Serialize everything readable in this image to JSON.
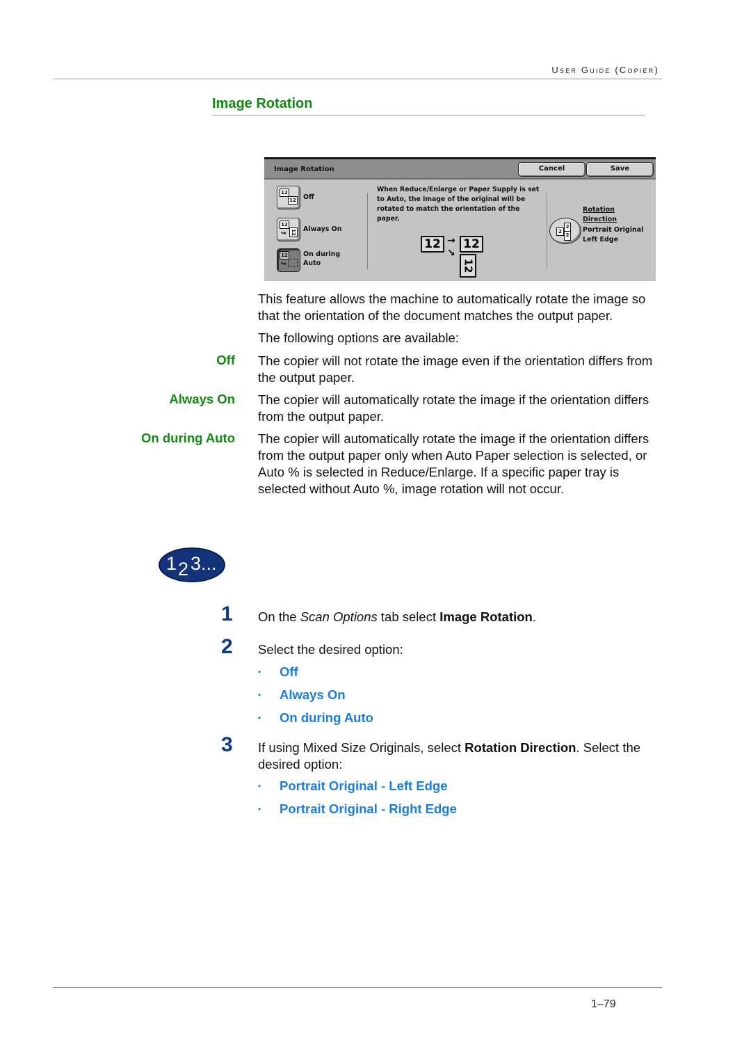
{
  "header": {
    "running_head": "User Guide (Copier)"
  },
  "section": {
    "title": "Image Rotation"
  },
  "screen": {
    "title": "Image Rotation",
    "cancel_label": "Cancel",
    "save_label": "Save",
    "options": [
      {
        "label_line1": "Off",
        "label_line2": "",
        "icon": "no-rotation-icon",
        "selected": false
      },
      {
        "label_line1": "Always On",
        "label_line2": "",
        "icon": "rotate-always-icon",
        "selected": false
      },
      {
        "label_line1": "On during",
        "label_line2": "Auto",
        "icon": "rotate-auto-icon",
        "selected": true
      }
    ],
    "description": "When Reduce/Enlarge or Paper Supply is set to Auto, the image of the original will be rotated to match the orientation of the paper.",
    "diagram": {
      "source": "12",
      "target": "12",
      "rotated": "12"
    },
    "rotation_title_line1": "Rotation",
    "rotation_title_line2": "Direction",
    "rotation_value_line1": "Portrait Original",
    "rotation_value_line2": "Left Edge"
  },
  "intro": {
    "p1": "This feature allows the machine to automatically rotate the image so that the orientation of the document matches the output paper.",
    "p2": "The following options are available:"
  },
  "definitions": [
    {
      "term": "Off",
      "text": "The copier will not rotate the image even if the orientation differs from the output paper."
    },
    {
      "term": "Always On",
      "text": "The copier will automatically rotate the image if the orientation differs from the output paper."
    },
    {
      "term": "On during Auto",
      "text": "The copier will automatically rotate the image if the orientation differs from the output paper only when Auto Paper selection is selected, or Auto % is selected in Reduce/Enlarge.  If a specific paper tray is selected without Auto %, image rotation will not occur."
    }
  ],
  "steps_badge": {
    "n1": "1",
    "n2": "2",
    "n3": "3..."
  },
  "steps": [
    {
      "num": "1",
      "pre": "On the ",
      "italic": "Scan Options",
      "mid": " tab select ",
      "bold": "Image Rotation",
      "post": "."
    },
    {
      "num": "2",
      "text": "Select the desired option:",
      "bullets": [
        "Off",
        "Always On",
        "On during Auto"
      ]
    },
    {
      "num": "3",
      "pre": "If using Mixed Size Originals, select ",
      "bold": "Rotation Direction",
      "post": ". Select the desired option:",
      "bullets": [
        "Portrait Original - Left Edge",
        "Portrait Original - Right Edge"
      ]
    }
  ],
  "footer": {
    "page_number": "1–79"
  },
  "colors": {
    "heading_green": "#128a12",
    "link_blue": "#1a7de0",
    "step_navy": "#123b85",
    "rule_green": "#5fb55f"
  }
}
